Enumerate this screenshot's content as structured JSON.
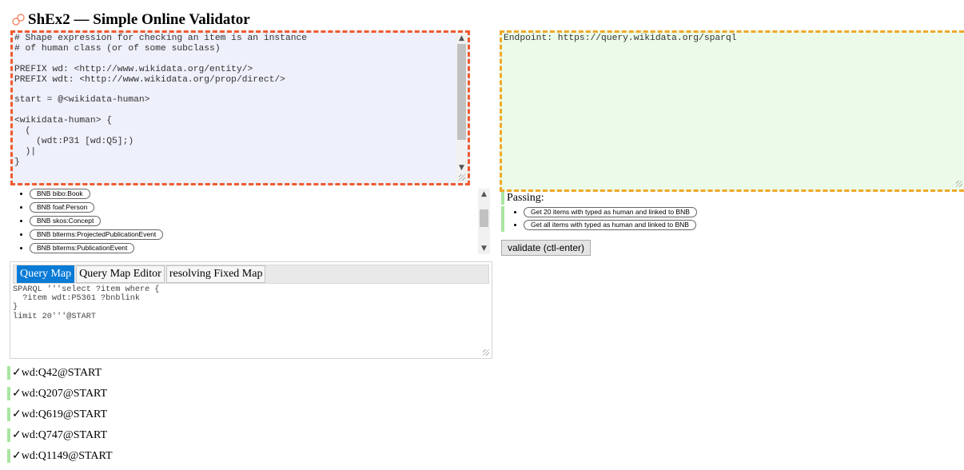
{
  "header": {
    "title": "ShEx2 — Simple Online Validator"
  },
  "schema": {
    "lines": [
      "# Shape expression for checking an item is an instance",
      "# of human class (or of some subclass)",
      "",
      "PREFIX wd: <http://www.wikidata.org/entity/>",
      "PREFIX wdt: <http://www.wikidata.org/prop/direct/>",
      "",
      "start = @<wikidata-human>",
      "",
      "<wikidata-human> {",
      "  (",
      "    (wdt:P31 [wd:Q5];)",
      "  )|",
      "}"
    ]
  },
  "data": {
    "text": "Endpoint: https://query.wikidata.org/sparql"
  },
  "manifest": {
    "items": [
      "BNB bibo:Book",
      "BNB foaf:Person",
      "BNB skos:Concept",
      "BNB blterms:ProjectedPublicationEvent",
      "BNB blterms:PublicationEvent"
    ]
  },
  "query_map": {
    "tabs": [
      "Query Map",
      "Query Map Editor",
      "resolving Fixed Map"
    ],
    "active_tab": "Query Map",
    "lines": [
      "SPARQL '''select ?item where {",
      "  ?item wdt:P5361 ?bnblink",
      "}",
      "limit 20'''@START"
    ]
  },
  "results": [
    "✓wd:Q42@START",
    "✓wd:Q207@START",
    "✓wd:Q619@START",
    "✓wd:Q747@START",
    "✓wd:Q1149@START"
  ],
  "passing": {
    "label": "Passing:",
    "items": [
      "Get 20 items with typed as human and linked to BNB",
      "Get all items with typed as human and linked to BNB"
    ]
  },
  "validate_label": "validate (ctl-enter)",
  "colors": {
    "schema_border": "#f05a2e",
    "schema_bg": "#eef0fb",
    "data_border": "#f0a829",
    "data_bg": "#ecfbe9",
    "pass_green": "#a8e6a0",
    "active_tab": "#0a7bd6"
  },
  "icons": {
    "logo": "shex-logo-icon",
    "scroll_up": "chevron-up-icon",
    "scroll_down": "chevron-down-icon"
  }
}
